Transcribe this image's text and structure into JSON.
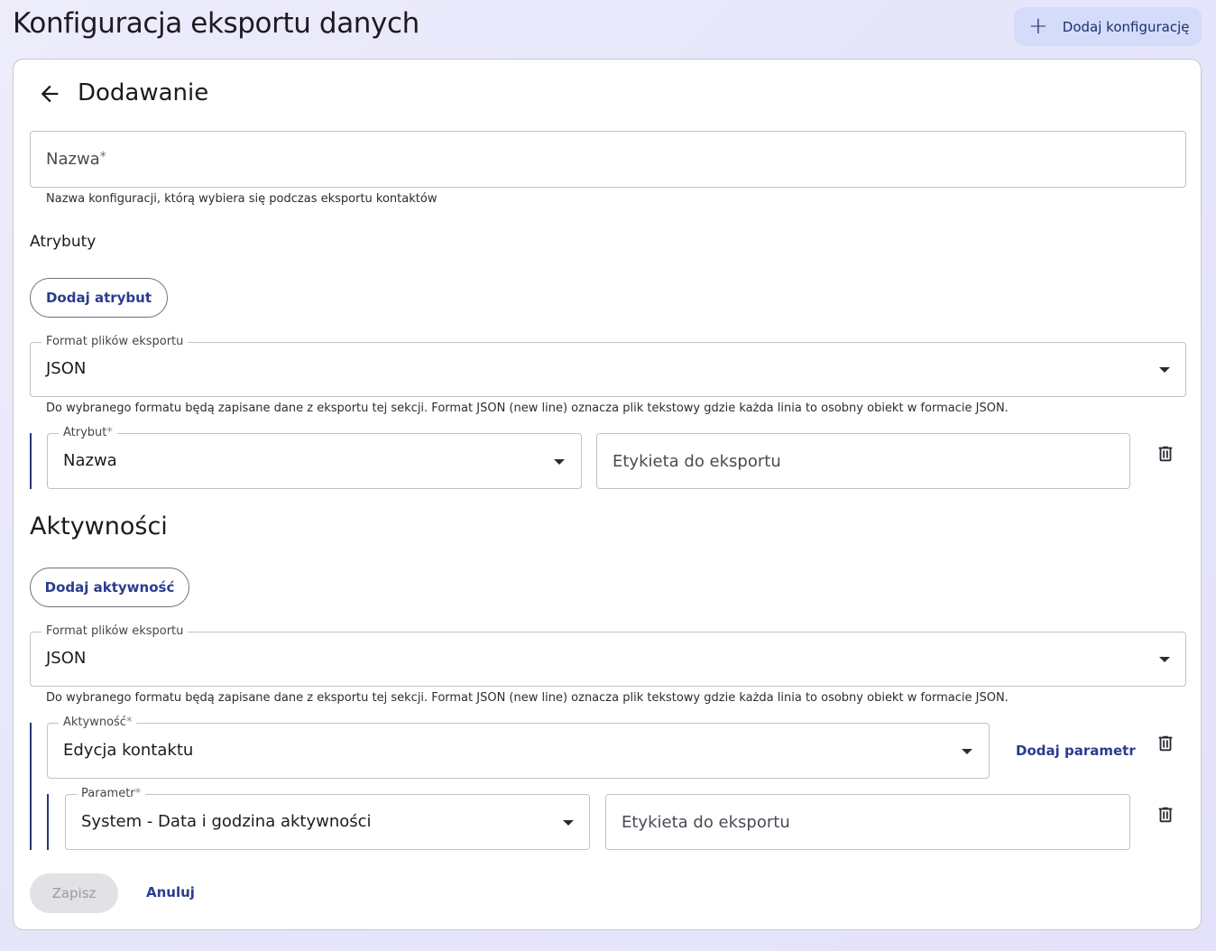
{
  "header": {
    "title": "Konfiguracja eksportu danych",
    "add_config_label": "Dodaj konfigurację",
    "add_config_icon": "plus-icon"
  },
  "card": {
    "back_icon": "arrow-left-icon",
    "title": "Dodawanie"
  },
  "name_field": {
    "placeholder": "Nazwa",
    "required_mark": "*",
    "helper": "Nazwa konfiguracji, którą wybiera się podczas eksportu kontaktów"
  },
  "attributes": {
    "label": "Atrybuty",
    "add_button": "Dodaj atrybut",
    "format": {
      "legend": "Format plików eksportu",
      "value": "JSON",
      "helper": "Do wybranego formatu będą zapisane dane z eksportu tej sekcji. Format JSON (new line) oznacza plik tekstowy gdzie każda linia to osobny obiekt w formacie JSON."
    },
    "row": {
      "attr_legend": "Atrybut",
      "required_mark": "*",
      "attr_value": "Nazwa",
      "label_placeholder": "Etykieta do eksportu",
      "delete_icon": "trash-icon"
    }
  },
  "activities": {
    "title": "Aktywności",
    "add_button": "Dodaj aktywność",
    "format": {
      "legend": "Format plików eksportu",
      "value": "JSON",
      "helper": "Do wybranego formatu będą zapisane dane z eksportu tej sekcji. Format JSON (new line) oznacza plik tekstowy gdzie każda linia to osobny obiekt w formacie JSON."
    },
    "row": {
      "activity_legend": "Aktywność",
      "required_mark": "*",
      "activity_value": "Edycja kontaktu",
      "add_param_label": "Dodaj parametr",
      "delete_icon": "trash-icon",
      "param": {
        "legend": "Parametr",
        "required_mark": "*",
        "value": "System - Data i godzina aktywności",
        "label_placeholder": "Etykieta do eksportu",
        "delete_icon": "trash-icon"
      }
    }
  },
  "footer": {
    "save_label": "Zapisz",
    "cancel_label": "Anuluj"
  },
  "colors": {
    "accent": "#2a3c8f",
    "top_button_bg": "#d4dcfa",
    "indicator_bar": "#2a3575"
  }
}
